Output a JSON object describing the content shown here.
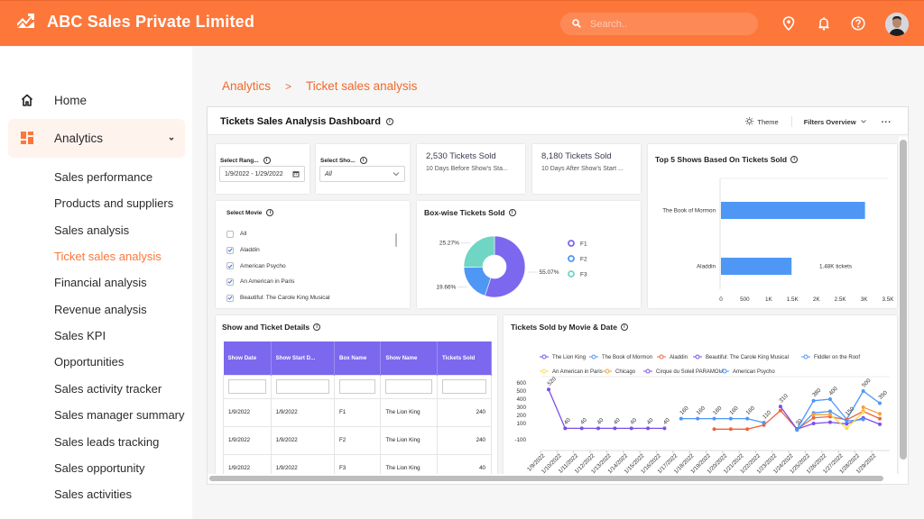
{
  "app": {
    "title": "ABC Sales Private Limited",
    "brand_icon": "trending-up-icon"
  },
  "header": {
    "search_placeholder": "Search..",
    "icons": [
      "location-pin-icon",
      "bell-icon",
      "help-icon"
    ],
    "avatar": "user-avatar"
  },
  "sidebar": {
    "home": {
      "label": "Home",
      "icon": "home-icon"
    },
    "analytics": {
      "label": "Analytics",
      "icon": "dashboard-icon",
      "expanded": true
    },
    "sub_items": [
      {
        "label": "Sales performance"
      },
      {
        "label": "Products and suppliers"
      },
      {
        "label": "Sales analysis"
      },
      {
        "label": "Ticket sales analysis",
        "active": true
      },
      {
        "label": "Financial analysis"
      },
      {
        "label": "Revenue analysis"
      },
      {
        "label": "Sales KPI"
      },
      {
        "label": "Opportunities"
      },
      {
        "label": "Sales activity tracker"
      },
      {
        "label": "Sales manager summary"
      },
      {
        "label": "Sales leads tracking"
      },
      {
        "label": "Sales opportunity"
      },
      {
        "label": "Sales activities"
      }
    ]
  },
  "breadcrumb": {
    "parent": "Analytics",
    "separator": ">",
    "current": "Ticket sales analysis"
  },
  "dashboard": {
    "title": "Tickets Sales Analysis Dashboard",
    "theme_label": "Theme",
    "filters_label": "Filters Overview",
    "more_label": "...",
    "range_filter": {
      "label": "Select Rang...",
      "value": "1/9/2022 - 1/29/2022"
    },
    "show_filter": {
      "label": "Select Sho...",
      "value": "All"
    },
    "kpi1": {
      "value": "2,530 Tickets Sold",
      "sub": "10 Days Before Show's Sta..."
    },
    "kpi2": {
      "value": "8,180 Tickets Sold",
      "sub": "10 Days After Show's Start ..."
    },
    "movie_filter": {
      "label": "Select Movie",
      "items": [
        {
          "label": "All",
          "checked": false
        },
        {
          "label": "Aladdin",
          "checked": true
        },
        {
          "label": "American Psycho",
          "checked": true
        },
        {
          "label": "An American in Paris",
          "checked": true
        },
        {
          "label": "Beautiful: The Carole King Musical",
          "checked": true
        }
      ]
    },
    "box_chart": {
      "title": "Box-wise Tickets Sold"
    },
    "top5_chart": {
      "title": "Top 5 Shows Based On Tickets Sold"
    },
    "table": {
      "title": "Show and Ticket Details",
      "columns": [
        "Show Date",
        "Show Start D...",
        "Box Name",
        "Show Name",
        "Tickets Sold"
      ],
      "rows": [
        [
          "1/9/2022",
          "1/9/2022",
          "F1",
          "The Lion King",
          "240"
        ],
        [
          "1/9/2022",
          "1/9/2022",
          "F2",
          "The Lion King",
          "240"
        ],
        [
          "1/9/2022",
          "1/9/2022",
          "F3",
          "The Lion King",
          "40"
        ]
      ]
    },
    "line_chart": {
      "title": "Tickets Sold by Movie & Date"
    }
  },
  "chart_data": [
    {
      "type": "pie",
      "title": "Box-wise Tickets Sold",
      "categories": [
        "F1",
        "F2",
        "F3"
      ],
      "values": [
        55.07,
        19.66,
        25.27
      ],
      "labels": [
        "55.07%",
        "19.66%",
        "25.27%"
      ],
      "colors": [
        "#7b68ee",
        "#4f97f5",
        "#6fd6c3"
      ],
      "donut": true,
      "legend": "right"
    },
    {
      "type": "bar",
      "orientation": "horizontal",
      "title": "Top 5 Shows Based On Tickets Sold",
      "categories": [
        "The Book of Mormon",
        "Aladdin"
      ],
      "values": [
        3020,
        1480
      ],
      "data_labels": [
        "",
        "1.48K tickets"
      ],
      "xlim": [
        0,
        3500
      ],
      "xticks": [
        "0",
        "500",
        "1K",
        "1.5K",
        "2K",
        "2.5K",
        "3K",
        "3.5K"
      ],
      "color": "#4f97f5"
    },
    {
      "type": "line",
      "title": "Tickets Sold by Movie & Date",
      "x": [
        "1/9/2022",
        "1/10/2022",
        "1/11/2022",
        "1/12/2022",
        "1/13/2022",
        "1/14/2022",
        "1/15/2022",
        "1/16/2022",
        "1/17/2022",
        "1/18/2022",
        "1/19/2022",
        "1/20/2022",
        "1/21/2022",
        "1/22/2022",
        "1/23/2022",
        "1/24/2022",
        "1/25/2022",
        "1/26/2022",
        "1/27/2022",
        "1/28/2022",
        "1/29/2022"
      ],
      "ylim": [
        -100,
        600
      ],
      "yticks": [
        "600",
        "500",
        "400",
        "300",
        "200",
        "100",
        "-100"
      ],
      "legend": "top",
      "series": [
        {
          "name": "The Lion King",
          "color": "#7b4fe8",
          "values": [
            520,
            40,
            40,
            40,
            40,
            40,
            40,
            40,
            null,
            null,
            null,
            null,
            null,
            null,
            null,
            null,
            null,
            null,
            null,
            null,
            null
          ]
        },
        {
          "name": "The Book of Mormon",
          "color": "#4f97f5",
          "values": [
            null,
            null,
            null,
            null,
            null,
            null,
            null,
            null,
            160,
            160,
            160,
            160,
            160,
            110,
            null,
            30,
            380,
            400,
            150,
            500,
            350
          ]
        },
        {
          "name": "Aladdin",
          "color": "#f0643c",
          "values": [
            null,
            null,
            null,
            null,
            null,
            null,
            null,
            null,
            null,
            null,
            30,
            30,
            30,
            80,
            260,
            30,
            170,
            185,
            145,
            250,
            160
          ]
        },
        {
          "name": "Beautiful: The Carole King Musical",
          "color": "#7b4fe8",
          "values": [
            null,
            null,
            null,
            null,
            null,
            null,
            null,
            null,
            null,
            null,
            null,
            null,
            null,
            null,
            310,
            30,
            100,
            115,
            95,
            170,
            90
          ]
        },
        {
          "name": "Fiddler on the Roof",
          "color": "#4f97f5",
          "values": [
            null,
            null,
            null,
            null,
            null,
            null,
            null,
            null,
            null,
            null,
            null,
            null,
            null,
            110,
            null,
            20,
            230,
            250,
            130,
            150,
            null
          ]
        },
        {
          "name": "An American in Paris",
          "color": "#f5e04c",
          "values": [
            null,
            null,
            null,
            null,
            null,
            null,
            null,
            null,
            null,
            null,
            null,
            null,
            null,
            null,
            null,
            null,
            210,
            210,
            40,
            240,
            null
          ]
        },
        {
          "name": "Chicago",
          "color": "#f0a23c",
          "values": [
            null,
            null,
            null,
            null,
            null,
            null,
            null,
            null,
            null,
            null,
            null,
            null,
            null,
            null,
            null,
            null,
            210,
            210,
            null,
            300,
            220
          ]
        },
        {
          "name": "Cirque du Soleil PARAMOUR",
          "color": "#7b4fe8",
          "values": []
        },
        {
          "name": "American Psycho",
          "color": "#4f97f5",
          "values": []
        }
      ],
      "data_labels": [
        "520",
        "40",
        "40",
        "40",
        "40",
        "40",
        "40",
        "40",
        "160",
        "160",
        "160",
        "160",
        "160",
        "110",
        "310",
        "30",
        "380",
        "400",
        "150",
        "500",
        "350"
      ]
    }
  ]
}
